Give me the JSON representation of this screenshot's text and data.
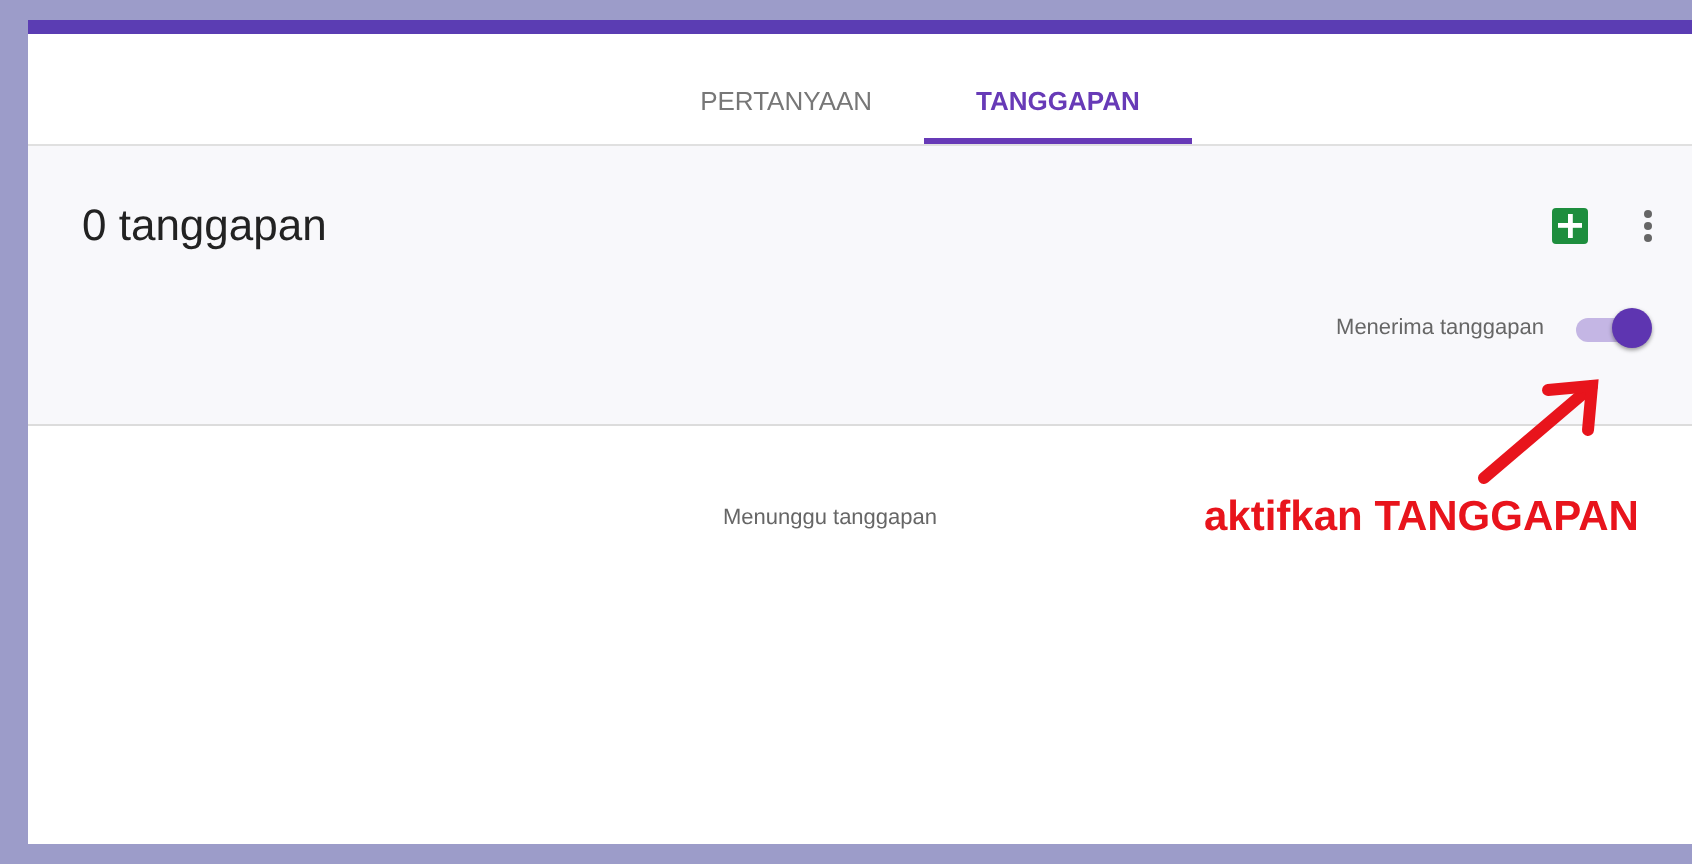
{
  "tabs": [
    {
      "label": "PERTANYAAN",
      "selected": false
    },
    {
      "label": "TANGGAPAN",
      "selected": true
    }
  ],
  "summary": {
    "title": "0 tanggapan"
  },
  "accepting_toggle": {
    "label": "Menerima tanggapan",
    "on": true
  },
  "empty_message": "Menunggu tanggapan",
  "annotation": {
    "text": "aktifkan TANGGAPAN"
  }
}
